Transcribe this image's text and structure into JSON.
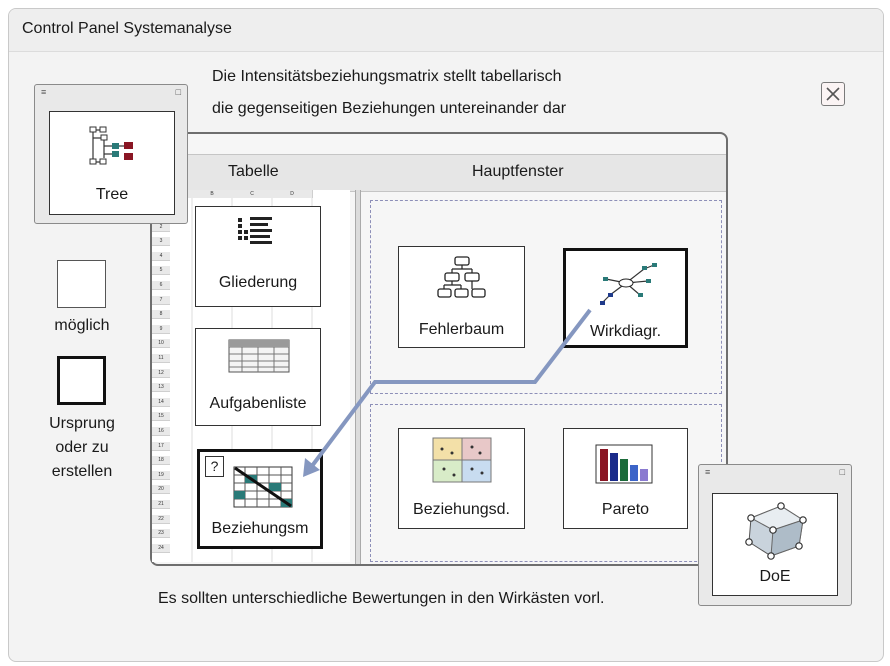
{
  "window": {
    "title": "Control Panel Systemanalyse",
    "description_line1": "Die Intensitätsbeziehungsmatrix stellt tabellarisch",
    "description_line2": "die gegenseitigen Beziehungen untereinander dar",
    "footer": "Es sollten unterschiedliche Bewertungen in den Wirkästen vorl."
  },
  "legend": {
    "possible_label": "möglich",
    "origin_label_line1": "Ursprung",
    "origin_label_line2": "oder zu",
    "origin_label_line3": "erstellen"
  },
  "columns": {
    "table_header": "Tabelle",
    "main_header": "Hauptfenster"
  },
  "sheet": {
    "column_headers": [
      "A",
      "B",
      "C",
      "D"
    ],
    "row_numbers": [
      "1",
      "2",
      "3",
      "4",
      "5",
      "6",
      "7",
      "8",
      "9",
      "10",
      "11",
      "12",
      "13",
      "14",
      "15",
      "16",
      "17",
      "18",
      "19",
      "20",
      "21",
      "22",
      "23",
      "24"
    ]
  },
  "table_cards": {
    "outline": "Gliederung",
    "task_list": "Aufgabenliste",
    "relation_matrix": "Beziehungsm",
    "relation_matrix_badge": "?"
  },
  "main_cards": {
    "fault_tree": "Fehlerbaum",
    "effect_diagram": "Wirkdiagr.",
    "relation_diagram": "Beziehungsd.",
    "pareto": "Pareto"
  },
  "floating_windows": {
    "tree": "Tree",
    "doe": "DoE"
  },
  "icons": {
    "close": "close-icon",
    "window_menu": "menu-icon",
    "window_restore": "restore-icon"
  },
  "colors": {
    "connector": "#8597c0",
    "pareto_bars": [
      "#8a1624",
      "#1a2a8a",
      "#1c6b3a",
      "#3c64c8",
      "#8a7ad0"
    ]
  }
}
